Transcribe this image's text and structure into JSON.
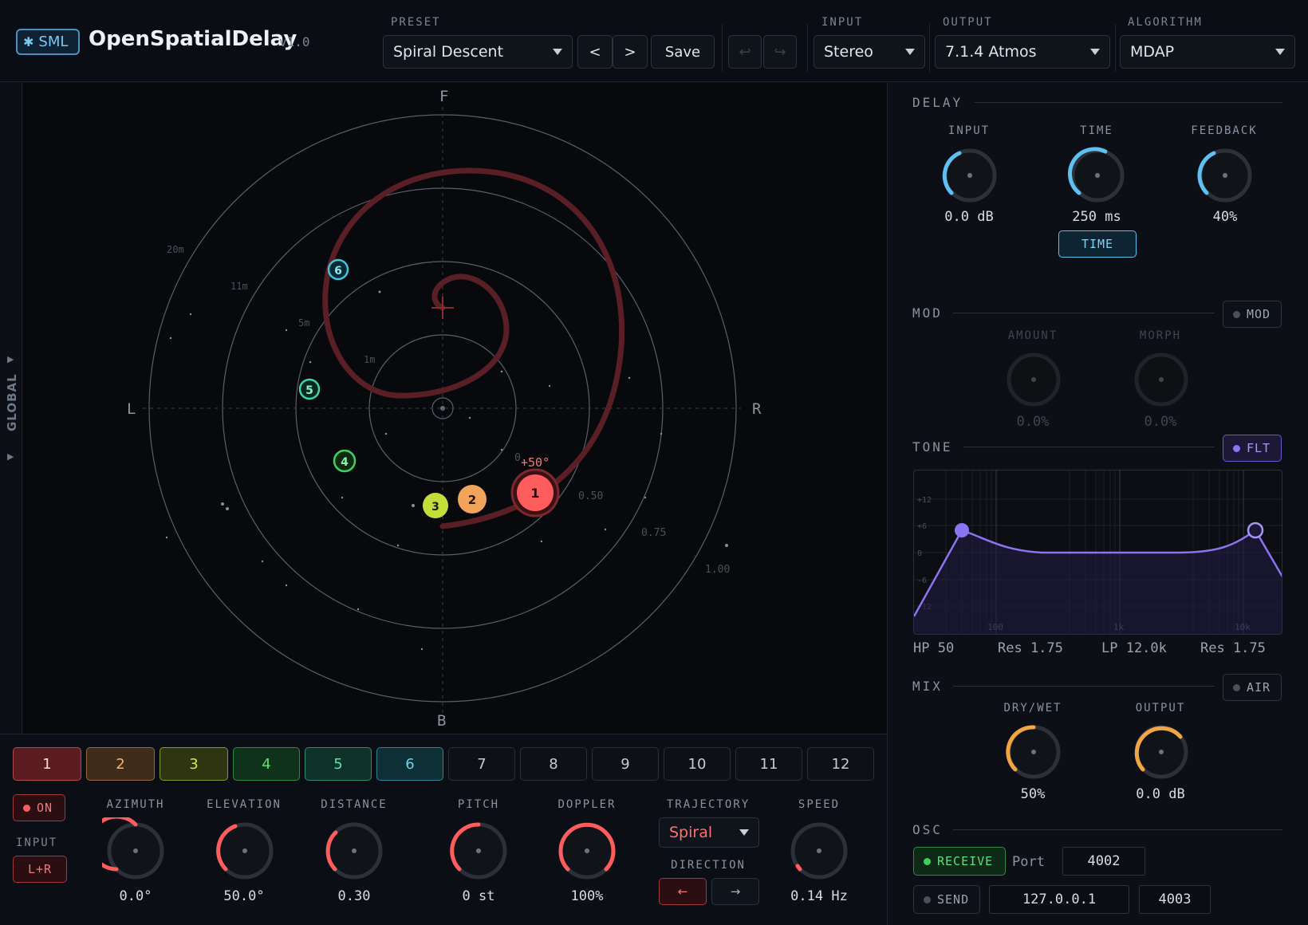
{
  "header": {
    "logo_text": "SML",
    "title": "OpenSpatialDelay",
    "version": "v1.0",
    "preset_label": "PRESET",
    "preset_value": "Spiral Descent",
    "prev_label": "<",
    "next_label": ">",
    "save_label": "Save",
    "undo_icon": "undo-icon",
    "redo_icon": "redo-icon",
    "input_label": "INPUT",
    "input_value": "Stereo",
    "output_label": "OUTPUT",
    "output_value": "7.1.4 Atmos",
    "algorithm_label": "ALGORITHM",
    "algorithm_value": "MDAP"
  },
  "sidebar": {
    "global_label": "GLOBAL"
  },
  "radar": {
    "front": "F",
    "back": "B",
    "left": "L",
    "right": "R",
    "ring_labels_dist": [
      "20m",
      "11m",
      "5m",
      "1m"
    ],
    "ring_labels_gain": [
      "0.50",
      "0.75",
      "1.00"
    ],
    "selected_angle": "+50°",
    "tap_label_partial": "0.",
    "accent": "#e35a5a",
    "taps": [
      {
        "id": "1",
        "color": "#ff5d5d",
        "azimuth_deg": 50,
        "distance": 0.3
      },
      {
        "id": "2",
        "color": "#f2a55a"
      },
      {
        "id": "3",
        "color": "#c5dd3a"
      },
      {
        "id": "4",
        "color": "#3fd15e"
      },
      {
        "id": "5",
        "color": "#3fd6a0"
      },
      {
        "id": "6",
        "color": "#3fc4d9"
      }
    ]
  },
  "tabs": [
    "1",
    "2",
    "3",
    "4",
    "5",
    "6",
    "7",
    "8",
    "9",
    "10",
    "11",
    "12"
  ],
  "tap_controls": {
    "on_label": "ON",
    "input_label": "INPUT",
    "input_value": "L+R",
    "azimuth_label": "AZIMUTH",
    "azimuth_value": "0.0°",
    "elevation_label": "ELEVATION",
    "elevation_value": "50.0°",
    "distance_label": "DISTANCE",
    "distance_value": "0.30",
    "pitch_label": "PITCH",
    "pitch_value": "0 st",
    "doppler_label": "DOPPLER",
    "doppler_value": "100%",
    "trajectory_label": "TRAJECTORY",
    "trajectory_value": "Spiral",
    "direction_label": "DIRECTION",
    "dir_left": "←",
    "dir_right": "→",
    "speed_label": "SPEED",
    "speed_value": "0.14 Hz"
  },
  "delay": {
    "section": "DELAY",
    "input_label": "INPUT",
    "input_value": "0.0 dB",
    "time_label": "TIME",
    "time_value": "250 ms",
    "feedback_label": "FEEDBACK",
    "feedback_value": "40%",
    "time_button": "TIME"
  },
  "mod": {
    "section": "MOD",
    "toggle": "MOD",
    "amount_label": "AMOUNT",
    "amount_value": "0.0%",
    "morph_label": "MORPH",
    "morph_value": "0.0%"
  },
  "tone": {
    "section": "TONE",
    "toggle": "FLT",
    "db_ticks": [
      "+12",
      "+6",
      "0",
      "-6",
      "-12"
    ],
    "freq_ticks": [
      "100",
      "1k",
      "10k"
    ],
    "hp_label": "HP 50",
    "hp_res": "Res 1.75",
    "lp_label": "LP 12.0k",
    "lp_res": "Res 1.75"
  },
  "mix": {
    "section": "MIX",
    "toggle": "AIR",
    "drywet_label": "DRY/WET",
    "drywet_value": "50%",
    "output_label": "OUTPUT",
    "output_value": "0.0 dB"
  },
  "osc": {
    "section": "OSC",
    "receive_label": "RECEIVE",
    "port_label": "Port",
    "port_value": "4002",
    "send_label": "SEND",
    "ip_value": "127.0.0.1",
    "send_port_value": "4003"
  }
}
